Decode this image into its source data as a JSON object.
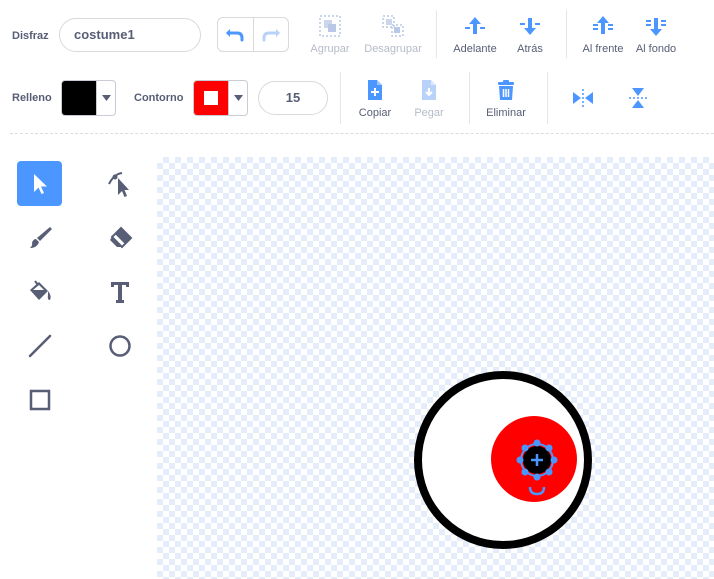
{
  "costume": {
    "label": "Disfraz",
    "name_value": "costume1"
  },
  "toolbar_top": {
    "group_label": "Agrupar",
    "ungroup_label": "Desagrupar",
    "forward_label": "Adelante",
    "backward_label": "Atrás",
    "front_label": "Al frente",
    "back_label": "Al fondo"
  },
  "fill": {
    "label": "Relleno",
    "color": "#000000"
  },
  "outline": {
    "label": "Contorno",
    "color": "#ff0000",
    "size": "15"
  },
  "toolbar_bottom": {
    "copy_label": "Copiar",
    "paste_label": "Pegar",
    "delete_label": "Eliminar"
  },
  "colors": {
    "accent": "#4c97ff",
    "text": "#575e75",
    "disabled": "#b6bbc8"
  },
  "tools": [
    "select-tool",
    "reshape-tool",
    "brush-tool",
    "eraser-tool",
    "fill-tool",
    "text-tool",
    "line-tool",
    "circle-tool",
    "rectangle-tool"
  ],
  "active_tool": "select-tool"
}
